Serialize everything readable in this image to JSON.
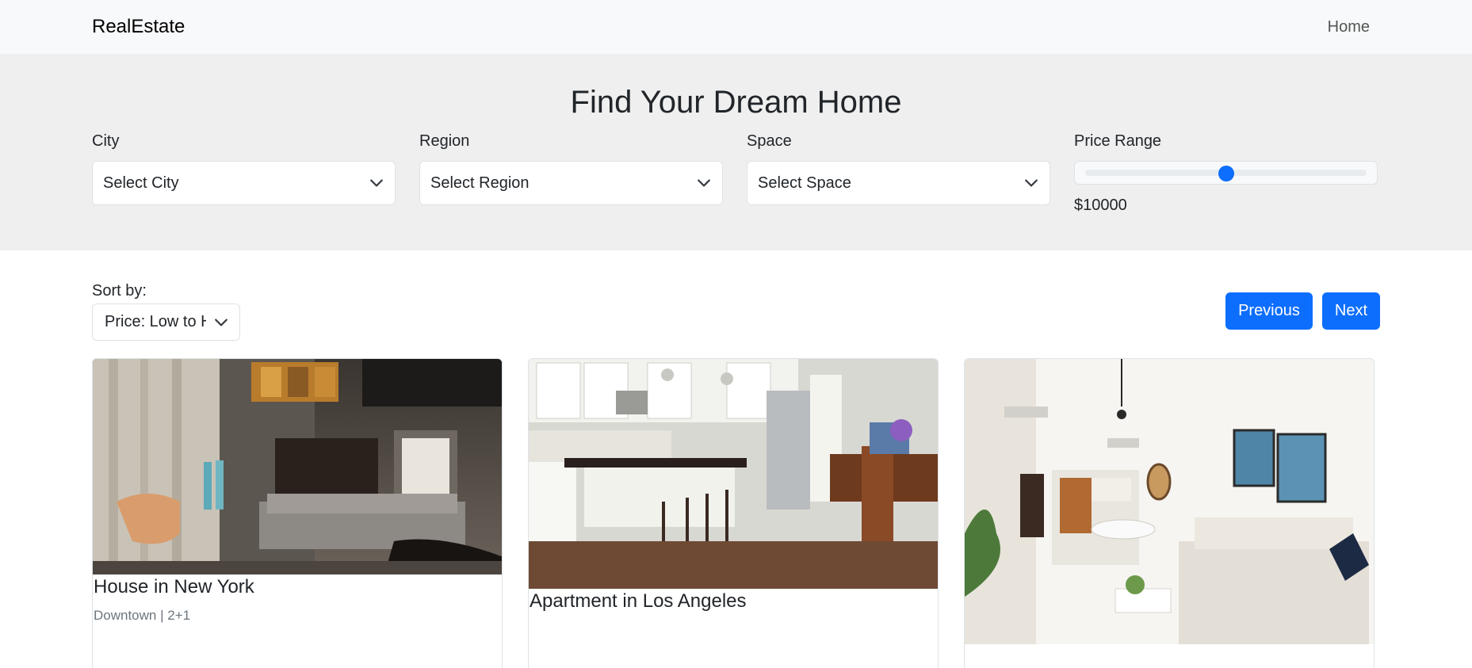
{
  "navbar": {
    "brand": "RealEstate",
    "home_link": "Home"
  },
  "hero": {
    "title": "Find Your Dream Home",
    "city": {
      "label": "City",
      "value": "Select City"
    },
    "region": {
      "label": "Region",
      "value": "Select Region"
    },
    "space": {
      "label": "Space",
      "value": "Select Space"
    },
    "price": {
      "label": "Price Range",
      "value_text": "$10000",
      "slider_fraction": 0.5
    }
  },
  "toolbar": {
    "sort_label": "Sort by:",
    "sort_value": "Price: Low to High",
    "previous_label": "Previous",
    "next_label": "Next"
  },
  "listings": [
    {
      "title": "House in New York",
      "subtitle": "Downtown | 2+1"
    },
    {
      "title": "Apartment in Los Angeles",
      "subtitle": ""
    },
    {
      "title": "",
      "subtitle": ""
    }
  ],
  "colors": {
    "accent": "#0d6efd",
    "navbar_bg": "#f8f9fa",
    "hero_bg": "#efefef"
  }
}
